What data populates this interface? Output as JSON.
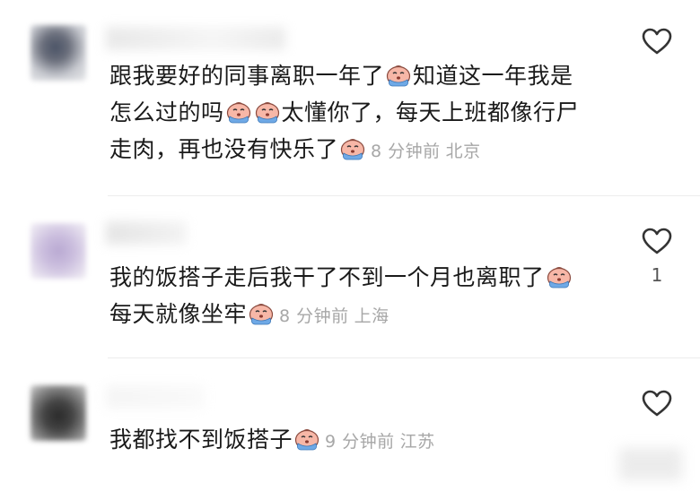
{
  "comments": [
    {
      "lines": [
        "跟我要好的同事离职一年了",
        "知道这一年我是",
        "怎么过的吗",
        "太懂你了，每天上班都像行尸",
        "走肉，再也没有快乐了"
      ],
      "time": "8 分钟前",
      "location": "北京",
      "likes": ""
    },
    {
      "lines": [
        "我的饭搭子走后我干了不到一个月也离职了",
        "每天就像坐牢"
      ],
      "time": "8 分钟前",
      "location": "上海",
      "likes": "1"
    },
    {
      "lines": [
        "我都找不到饭搭子"
      ],
      "time": "9 分钟前",
      "location": "江苏",
      "likes": ""
    }
  ],
  "icons": {
    "like": "heart-outline-icon",
    "emoji": "crying-emoji-icon"
  },
  "colors": {
    "meta_text": "#a7a7a7",
    "divider": "#ececec",
    "emoji_face": "#f6b3a6",
    "emoji_tears": "#7fb4ea"
  }
}
